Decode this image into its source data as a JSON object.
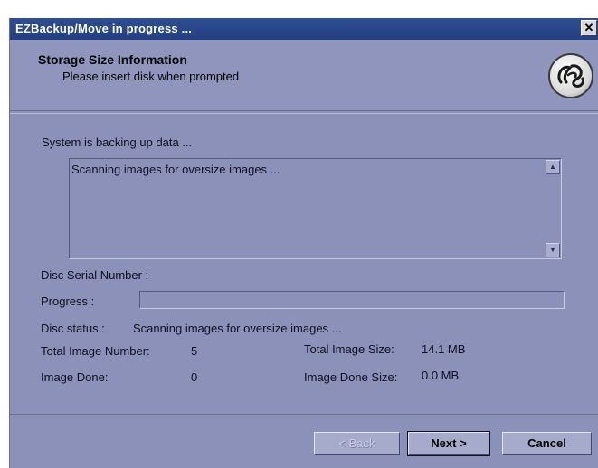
{
  "window": {
    "title": "EZBackup/Move in progress ...",
    "close_glyph": "✕"
  },
  "header": {
    "title": "Storage Size Information",
    "subtitle": "Please insert disk when prompted",
    "logo_icon": "ge-logo"
  },
  "section": {
    "label": "System is backing up data ..."
  },
  "log": {
    "text": "Scanning images for oversize images ..."
  },
  "disc": {
    "serial_label": "Disc Serial Number :",
    "serial_value": ""
  },
  "progress": {
    "label": "Progress :",
    "fraction": 0
  },
  "status": {
    "label": "Disc status :",
    "value": "Scanning images for oversize images ..."
  },
  "stats": {
    "total_number_label": "Total Image Number:",
    "total_number_value": "5",
    "total_size_label": "Total Image Size:",
    "total_size_value": "14.1 MB",
    "done_label": "Image Done:",
    "done_value": "0",
    "done_size_label": "Image Done Size:",
    "done_size_value": "0.0 MB"
  },
  "buttons": {
    "back": "< Back",
    "next": "Next >",
    "cancel": "Cancel"
  },
  "colors": {
    "window_bg": "#8b91b9",
    "titlebar": "#2f4f93"
  }
}
